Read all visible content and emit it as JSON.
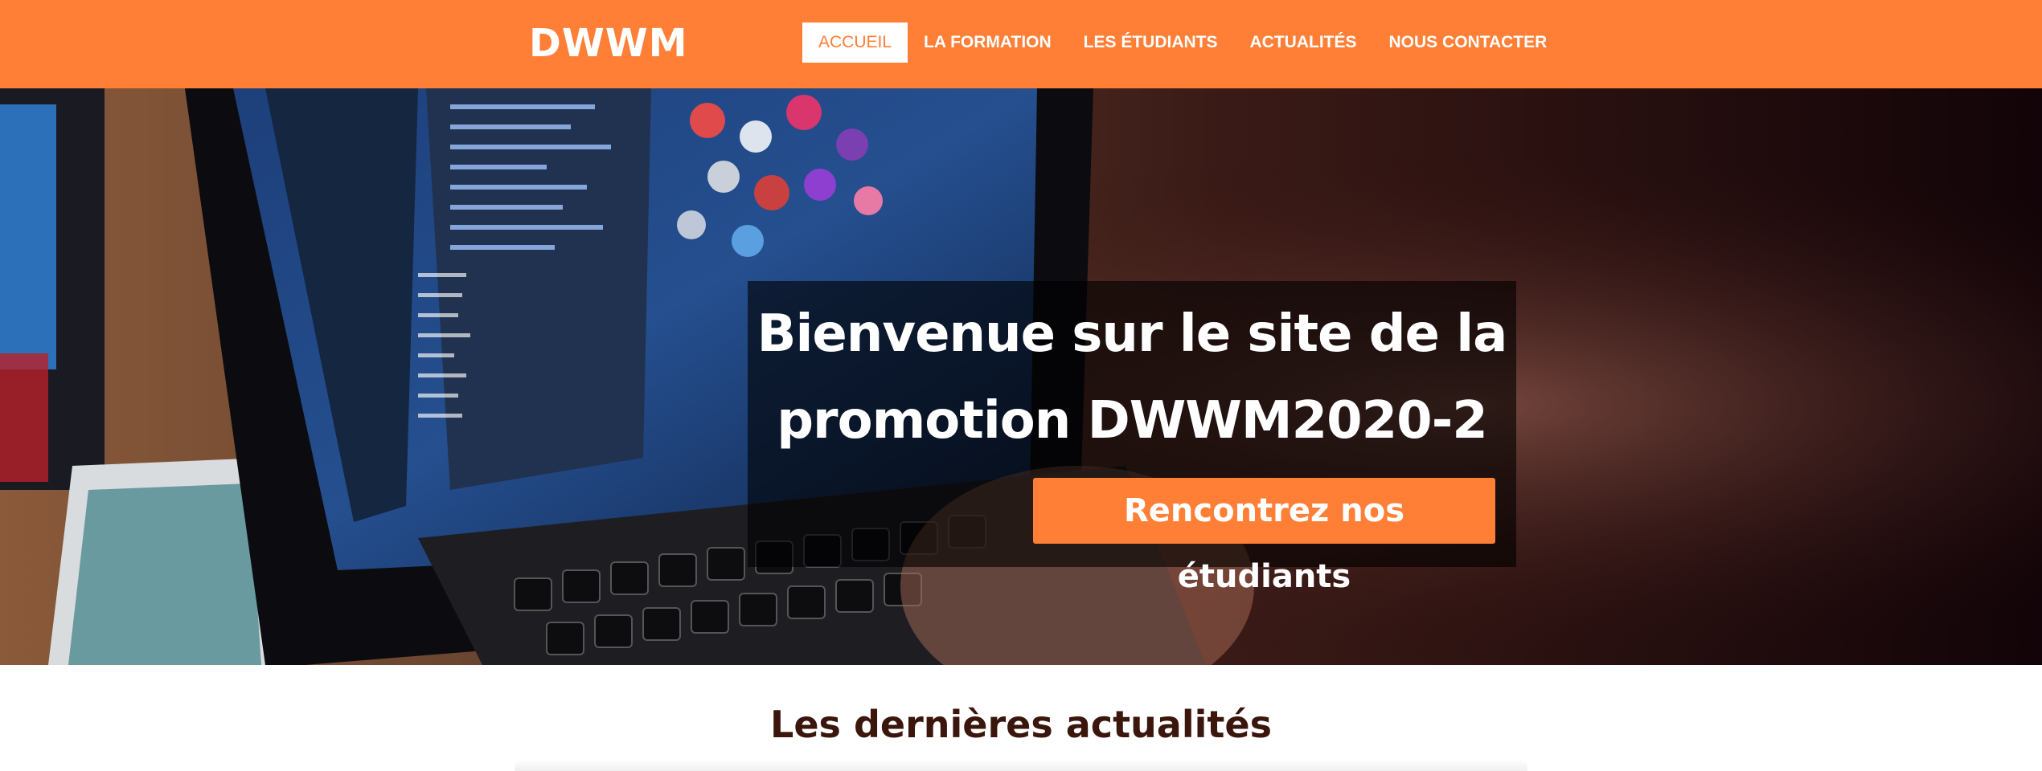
{
  "navbar": {
    "brand": "DWWM",
    "items": [
      {
        "label": "ACCUEIL",
        "active": true
      },
      {
        "label": "LA FORMATION"
      },
      {
        "label": "LES ÉTUDIANTS"
      },
      {
        "label": "ACTUALITÉS"
      },
      {
        "label": "NOUS CONTACTER"
      }
    ]
  },
  "hero": {
    "title_line1": "Bienvenue sur le site de la",
    "title_line2": "promotion DWWM2020-2",
    "cta_label": "Rencontrez nos étudiants"
  },
  "news": {
    "title": "Les dernières actualités"
  },
  "colors": {
    "accent": "#ff7f36",
    "heading": "#3a160c"
  }
}
